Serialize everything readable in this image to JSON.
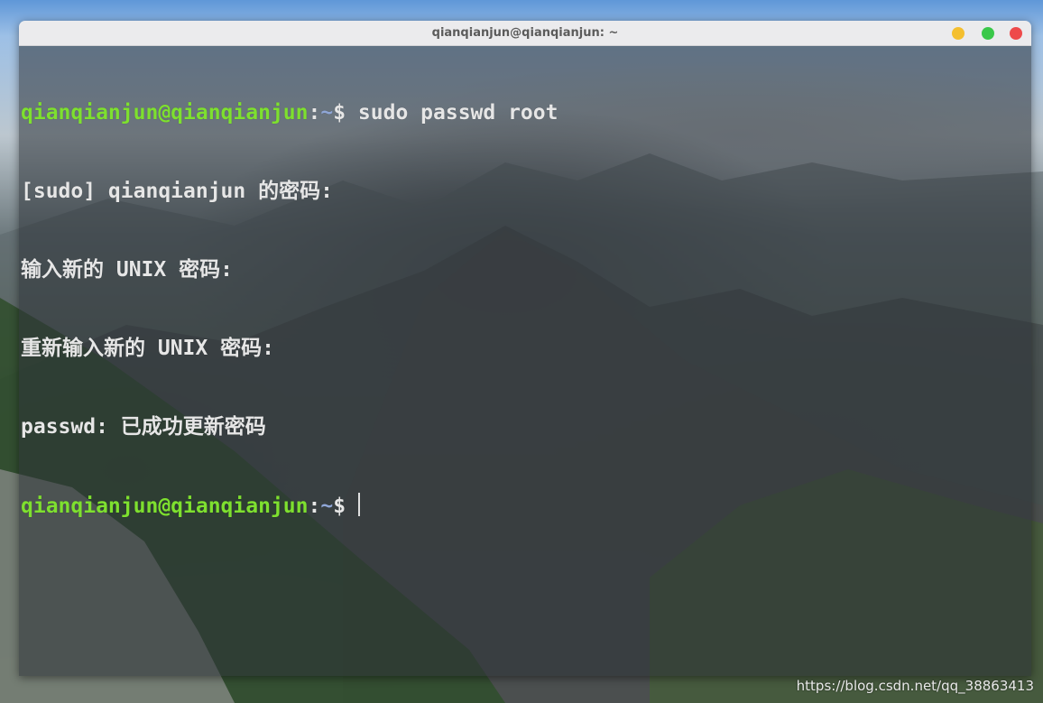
{
  "window": {
    "title": "qianqianjun@qianqianjun: ~",
    "controls": {
      "minimize_color": "#f4bf2f",
      "maximize_color": "#3ac84a",
      "close_color": "#ee4a4a"
    }
  },
  "terminal": {
    "colors": {
      "user": "#7ee02f",
      "path": "#8fa6d6",
      "text": "#e6e6e6"
    },
    "lines": [
      {
        "user": "qianqianjun@qianqianjun",
        "colon": ":",
        "path": "~",
        "prompt": "$ ",
        "command": "sudo passwd root"
      },
      {
        "text": "[sudo] qianqianjun 的密码:"
      },
      {
        "text": "输入新的 UNIX 密码:"
      },
      {
        "text": "重新输入新的 UNIX 密码:"
      },
      {
        "text": "passwd: 已成功更新密码"
      },
      {
        "user": "qianqianjun@qianqianjun",
        "colon": ":",
        "path": "~",
        "prompt": "$",
        "command": ""
      }
    ]
  },
  "watermark": "https://blog.csdn.net/qq_38863413"
}
